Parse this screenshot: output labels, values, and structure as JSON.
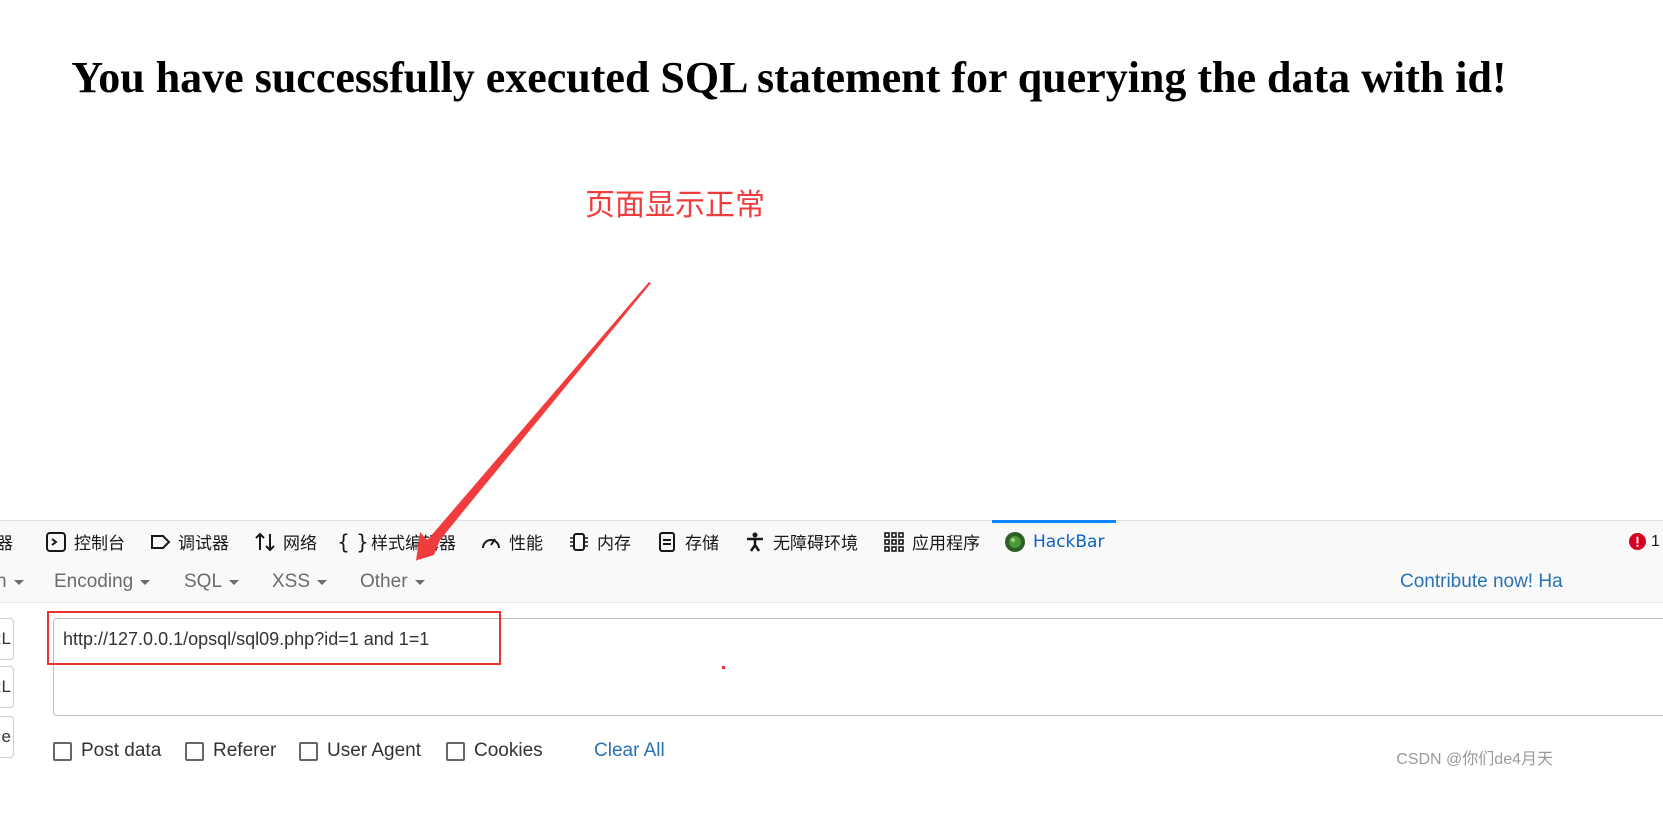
{
  "page": {
    "title": "You have successfully executed SQL statement for querying the data with id!",
    "annotation": "页面显示正常"
  },
  "colors": {
    "annotation": "#f03c3c",
    "accent": "#0a84ff",
    "link": "#2a72b5"
  },
  "devtools": {
    "tabs": [
      {
        "label": "器",
        "icon": "inspector-icon"
      },
      {
        "label": "控制台",
        "icon": "console-icon"
      },
      {
        "label": "调试器",
        "icon": "debugger-icon"
      },
      {
        "label": "网络",
        "icon": "network-icon"
      },
      {
        "label": "样式编辑器",
        "icon": "style-editor-icon"
      },
      {
        "label": "性能",
        "icon": "performance-icon"
      },
      {
        "label": "内存",
        "icon": "memory-icon"
      },
      {
        "label": "存储",
        "icon": "storage-icon"
      },
      {
        "label": "无障碍环境",
        "icon": "accessibility-icon"
      },
      {
        "label": "应用程序",
        "icon": "application-icon"
      },
      {
        "label": "HackBar",
        "icon": "hackbar-icon",
        "active": true
      }
    ],
    "error_count": "1"
  },
  "hackbar": {
    "menu": {
      "first_partial": "n",
      "encoding": "Encoding",
      "sql": "SQL",
      "xss": "XSS",
      "other": "Other",
      "contribute": "Contribute now! Ha"
    },
    "side_buttons": [
      "RL",
      "RL",
      "e"
    ],
    "url": "http://127.0.0.1/opsql/sql09.php?id=1 and 1=1",
    "options": {
      "post_data": "Post data",
      "referer": "Referer",
      "user_agent": "User Agent",
      "cookies": "Cookies",
      "clear_all": "Clear All"
    }
  },
  "watermark": "CSDN @你们de4月天"
}
